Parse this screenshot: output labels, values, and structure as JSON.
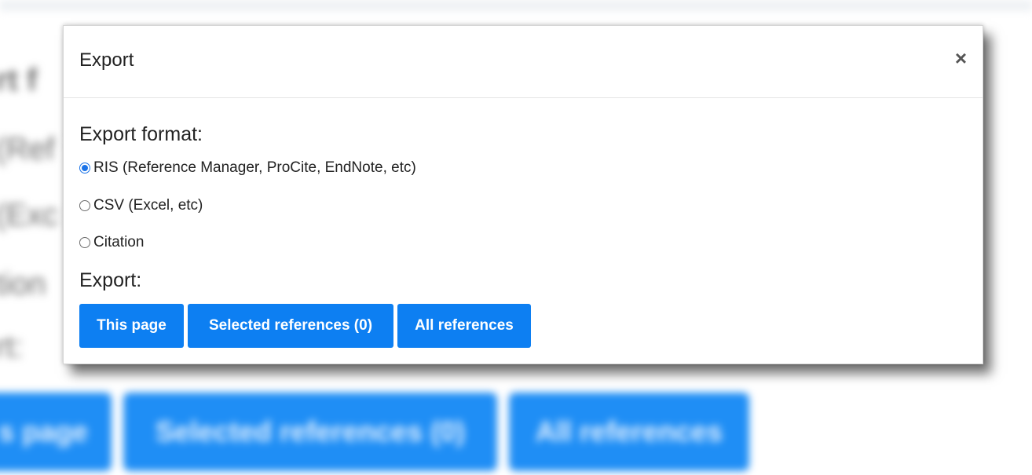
{
  "background": {
    "partial_texts": [
      "rt f",
      "(Ref",
      "(Exc",
      "tion",
      "rt:"
    ],
    "buttons": [
      "s page",
      "Selected references (0)",
      "All references"
    ]
  },
  "modal": {
    "title": "Export",
    "close_symbol": "×",
    "format_label": "Export format:",
    "formats": [
      {
        "label": "RIS (Reference Manager, ProCite, EndNote, etc)",
        "selected": true
      },
      {
        "label": "CSV (Excel, etc)",
        "selected": false
      },
      {
        "label": "Citation",
        "selected": false
      }
    ],
    "export_label": "Export:",
    "buttons": {
      "this_page": "This page",
      "selected": "Selected references (0)",
      "all": "All references"
    }
  },
  "colors": {
    "primary": "#0d7ff2",
    "radio_accent": "#1a73e8"
  }
}
